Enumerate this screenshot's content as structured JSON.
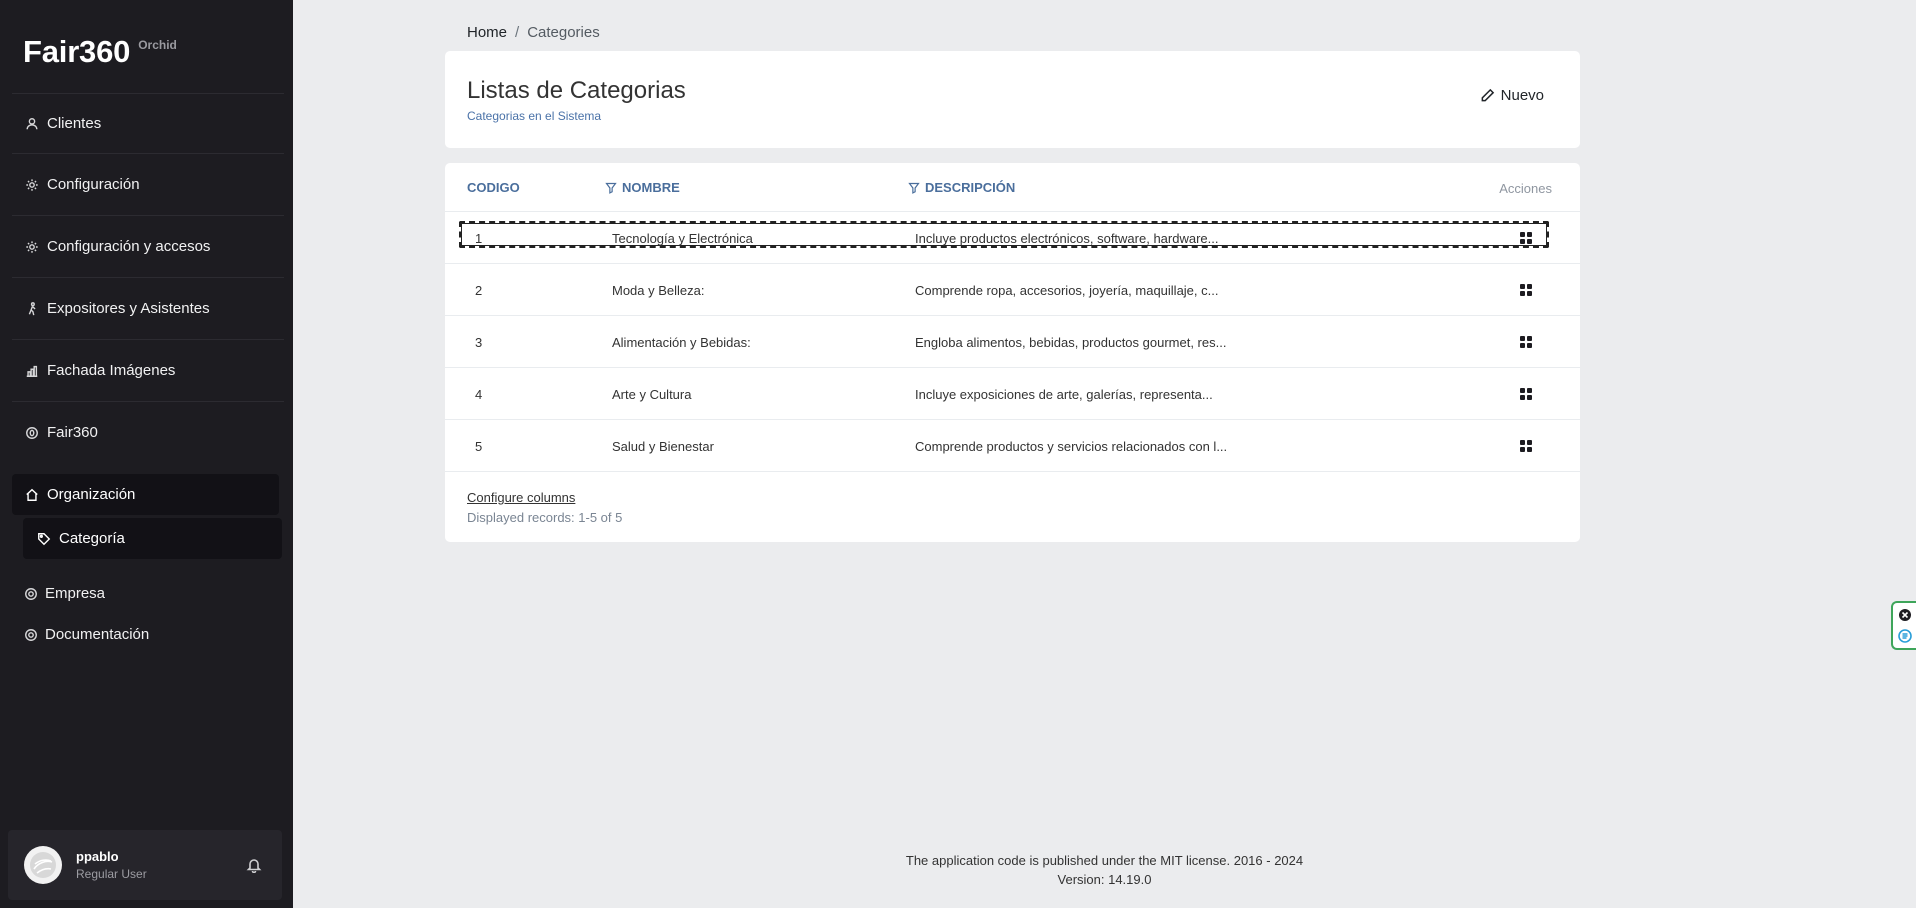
{
  "sidebar": {
    "brand": "Fair360",
    "brand_sub": "Orchid",
    "items": [
      {
        "label": "Clientes",
        "icon": "user-icon"
      },
      {
        "label": "Configuración",
        "icon": "gear-icon"
      },
      {
        "label": "Configuración y accesos",
        "icon": "gear-icon"
      },
      {
        "label": "Expositores y Asistentes",
        "icon": "person-walking-icon"
      },
      {
        "label": "Fachada Imágenes",
        "icon": "bar-chart-icon"
      },
      {
        "label": "Fair360",
        "icon": "circle-icon"
      }
    ],
    "active": {
      "label": "Organización",
      "icon": "house-icon"
    },
    "sub_active": {
      "label": "Categoría",
      "icon": "tag-icon"
    },
    "extra": [
      {
        "label": "Empresa",
        "icon": "gear-icon"
      },
      {
        "label": "Documentación",
        "icon": "gear-icon"
      }
    ],
    "user": {
      "name": "ppablo",
      "role": "Regular User"
    }
  },
  "breadcrumb": {
    "home": "Home",
    "separator": "/",
    "current": "Categories"
  },
  "header": {
    "title": "Listas de Categorias",
    "subtitle": "Categorias en el Sistema",
    "new_label": "Nuevo"
  },
  "table": {
    "columns": {
      "codigo": "CODIGO",
      "nombre": "NOMBRE",
      "descripcion": "DESCRIPCIÓN",
      "acciones": "Acciones"
    },
    "rows": [
      {
        "codigo": "1",
        "nombre": "Tecnología y Electrónica",
        "descripcion": "Incluye productos electrónicos, software, hardware..."
      },
      {
        "codigo": "2",
        "nombre": "Moda y Belleza:",
        "descripcion": "Comprende ropa, accesorios, joyería, maquillaje, c..."
      },
      {
        "codigo": "3",
        "nombre": "Alimentación y Bebidas:",
        "descripcion": "Engloba alimentos, bebidas, productos gourmet, res..."
      },
      {
        "codigo": "4",
        "nombre": "Arte y Cultura",
        "descripcion": "Incluye exposiciones de arte, galerías, representa..."
      },
      {
        "codigo": "5",
        "nombre": "Salud y Bienestar",
        "descripcion": "Comprende productos y servicios relacionados con l..."
      }
    ],
    "configure_label": "Configure columns",
    "records_label": "Displayed records: 1-5 of 5"
  },
  "footer": {
    "license": "The application code is published under the MIT license. 2016 - 2024",
    "version": "Version: 14.19.0"
  },
  "colors": {
    "sidebar_bg": "#1d1c21",
    "accent_blue": "#4a6e9c",
    "widget_green": "#3ea55a"
  }
}
